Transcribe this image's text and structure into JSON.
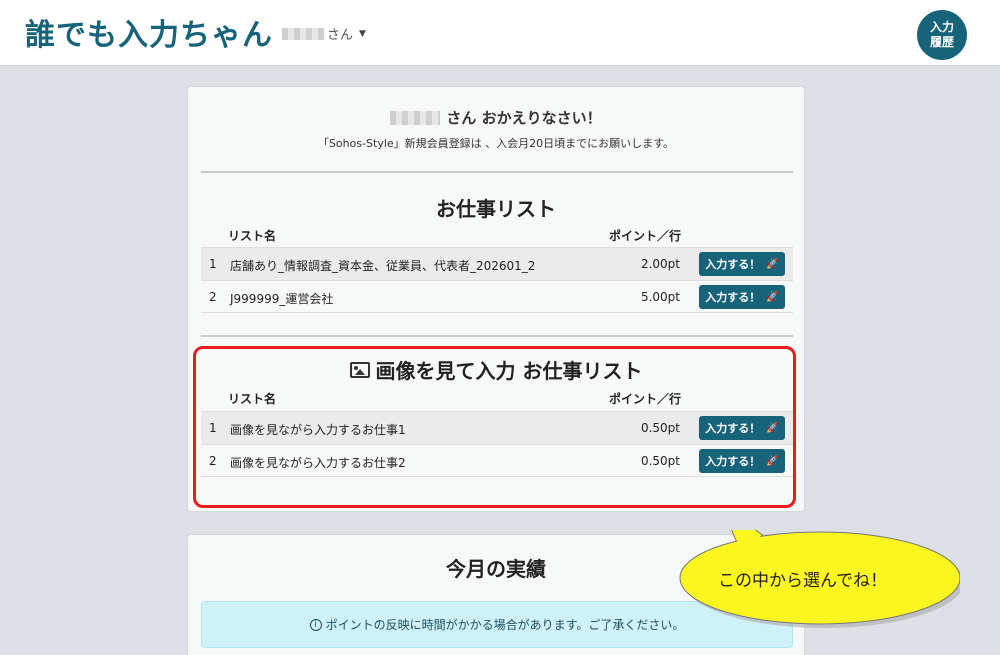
{
  "header": {
    "app_title": "誰でも入力ちゃん",
    "user_suffix": "さん",
    "history_line1": "入力",
    "history_line2": "履歴"
  },
  "welcome": {
    "greeting": "さん おかえりなさい！",
    "notice": "「Sohos-Style」新規会員登録は 、入会月20日頃までにお願いします。"
  },
  "job_list": {
    "title": "お仕事リスト",
    "col_name": "リスト名",
    "col_points": "ポイント／行",
    "rows": [
      {
        "num": "1",
        "name": "店舗あり_情報調査_資本金、従業員、代表者_202601_2",
        "points": "2.00pt",
        "button": "入力する！"
      },
      {
        "num": "2",
        "name": "J999999_運営会社",
        "points": "5.00pt",
        "button": "入力する！"
      }
    ]
  },
  "image_job_list": {
    "title": "画像を見て入力 お仕事リスト",
    "col_name": "リスト名",
    "col_points": "ポイント／行",
    "rows": [
      {
        "num": "1",
        "name": "画像を見ながら入力するお仕事1",
        "points": "0.50pt",
        "button": "入力する！"
      },
      {
        "num": "2",
        "name": "画像を見ながら入力するお仕事2",
        "points": "0.50pt",
        "button": "入力する！"
      }
    ]
  },
  "monthly": {
    "title": "今月の実績",
    "alert": "ポイントの反映に時間がかかる場合があります。ご了承ください。"
  },
  "callout": {
    "text": "この中から選んでね！"
  },
  "colors": {
    "brand": "#17637a",
    "highlight": "#ea1c1c",
    "callout": "#fcf620"
  }
}
